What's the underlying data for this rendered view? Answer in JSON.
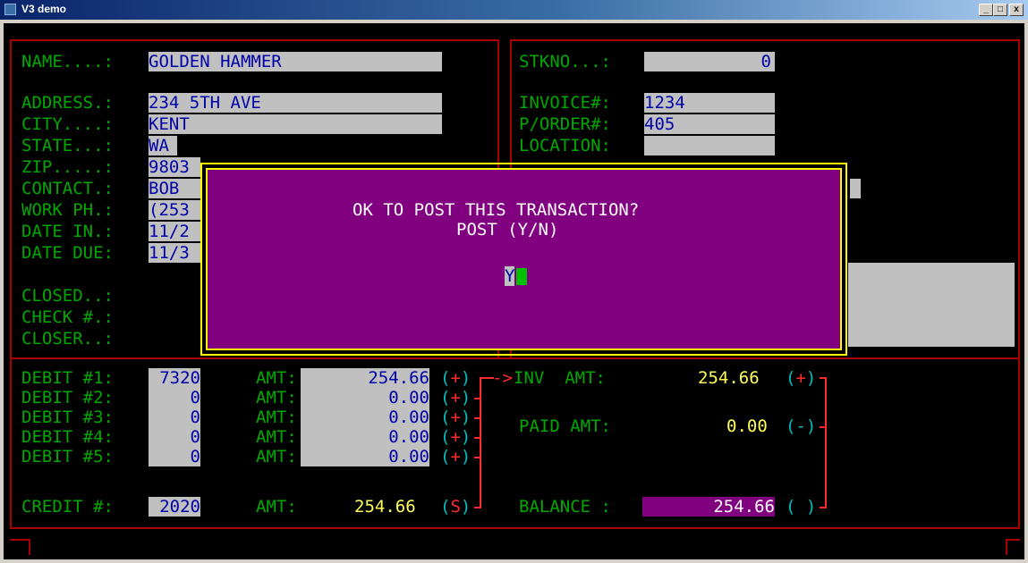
{
  "window": {
    "title": "V3 demo",
    "min": "_",
    "max": "□",
    "close": "x"
  },
  "customer": {
    "name_label": "NAME....:",
    "name": "GOLDEN HAMMER",
    "address_label": "ADDRESS.:",
    "address": "234 5TH AVE",
    "city_label": "CITY....:",
    "city": "KENT",
    "state_label": "STATE...:",
    "state": "WA",
    "zip_label": "ZIP.....:",
    "zip": "9803",
    "contact_label": "CONTACT.:",
    "contact": "BOB",
    "work_ph_label": "WORK PH.:",
    "work_ph": "(253",
    "date_in_label": "DATE IN.:",
    "date_in": "11/2",
    "date_due_label": "DATE DUE:",
    "date_due": "11/3",
    "closed_label": "CLOSED..:",
    "check_label": "CHECK #.:",
    "closer_label": "CLOSER..:"
  },
  "order": {
    "stkno_label": "STKNO...:",
    "stkno": "0",
    "invoice_label": "INVOICE#:",
    "invoice": "1234",
    "porder_label": "P/ORDER#:",
    "porder": "405",
    "location_label": "LOCATION:"
  },
  "debits": [
    {
      "label": "DEBIT #1:",
      "acct": "7320",
      "amt_label": "AMT:",
      "amt": "254.66",
      "sign": "(+)"
    },
    {
      "label": "DEBIT #2:",
      "acct": "0",
      "amt_label": "AMT:",
      "amt": "0.00",
      "sign": "(+)"
    },
    {
      "label": "DEBIT #3:",
      "acct": "0",
      "amt_label": "AMT:",
      "amt": "0.00",
      "sign": "(+)"
    },
    {
      "label": "DEBIT #4:",
      "acct": "0",
      "amt_label": "AMT:",
      "amt": "0.00",
      "sign": "(+)"
    },
    {
      "label": "DEBIT #5:",
      "acct": "0",
      "amt_label": "AMT:",
      "amt": "0.00",
      "sign": "(+)"
    }
  ],
  "credit": {
    "label": "CREDIT #:",
    "acct": "2020",
    "amt_label": "AMT:",
    "amt": "254.66",
    "sign_open": "(",
    "sign_letter": "S",
    "sign_close": ")"
  },
  "totals": {
    "arrow": "->",
    "inv_label": "INV  AMT:",
    "inv": "254.66",
    "inv_sign": "(+)",
    "paid_label": "PAID AMT:",
    "paid": "0.00",
    "paid_sign": "(-)",
    "balance_label": "BALANCE :",
    "balance": "254.66",
    "balance_sign": "( )"
  },
  "dialog": {
    "message": "OK TO POST THIS TRANSACTION?",
    "prompt": "POST (Y/N)",
    "answer": "Y"
  },
  "colors": {
    "console_bg": "#000000",
    "field_bg": "#c0c0c0",
    "dialog_bg": "#800080",
    "label": "#00a800",
    "value": "#ffff55",
    "border": "#a80000"
  }
}
